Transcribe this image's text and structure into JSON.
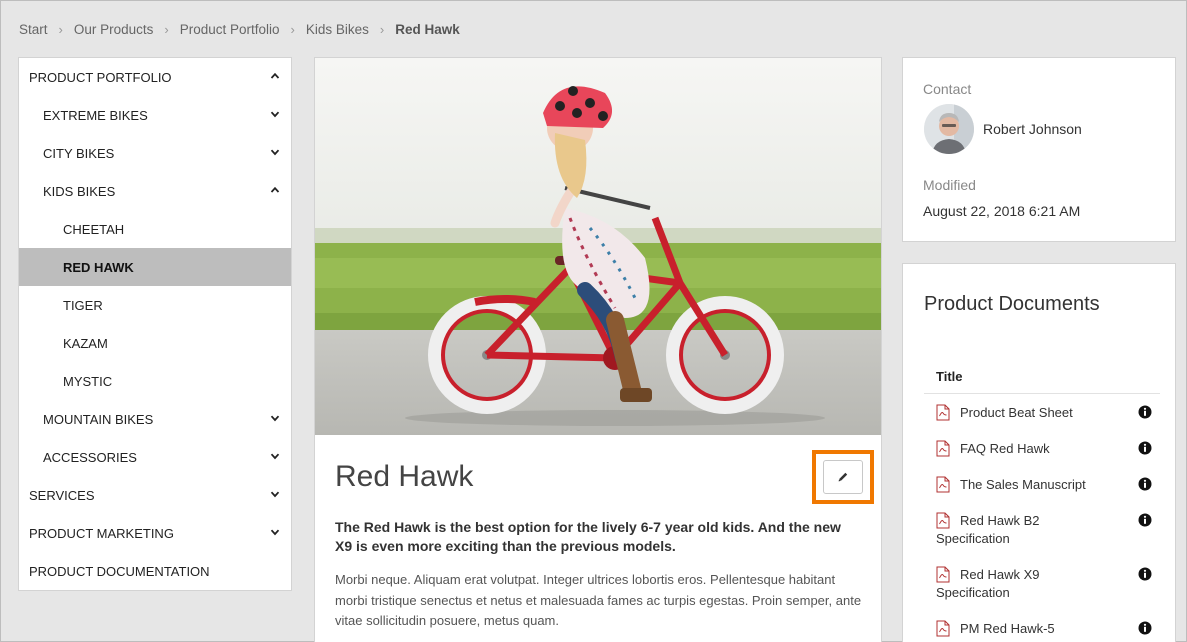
{
  "breadcrumb": {
    "items": [
      "Start",
      "Our Products",
      "Product Portfolio",
      "Kids Bikes"
    ],
    "current": "Red Hawk"
  },
  "nav": {
    "items": [
      {
        "label": "PRODUCT PORTFOLIO",
        "state": "expanded"
      },
      {
        "label": "EXTREME BIKES",
        "state": "collapsed"
      },
      {
        "label": "CITY BIKES",
        "state": "collapsed"
      },
      {
        "label": "KIDS BIKES",
        "state": "expanded"
      },
      {
        "label": "CHEETAH"
      },
      {
        "label": "RED HAWK",
        "active": true
      },
      {
        "label": "TIGER"
      },
      {
        "label": "KAZAM"
      },
      {
        "label": "MYSTIC"
      },
      {
        "label": "MOUNTAIN BIKES",
        "state": "collapsed"
      },
      {
        "label": "ACCESSORIES",
        "state": "collapsed"
      },
      {
        "label": "SERVICES",
        "state": "collapsed"
      },
      {
        "label": "PRODUCT MARKETING",
        "state": "collapsed"
      },
      {
        "label": "PRODUCT DOCUMENTATION"
      }
    ]
  },
  "product": {
    "title": "Red Hawk",
    "lead": "The Red Hawk is the best option for the lively 6-7 year old kids. And the new X9 is even more exciting than the previous models.",
    "body": "Morbi neque. Aliquam erat volutpat. Integer ultrices lobortis eros. Pellentesque habitant morbi tristique senectus et netus et malesuada fames ac turpis egestas. Proin semper, ante vitae sollicitudin posuere, metus quam."
  },
  "contact": {
    "label": "Contact",
    "name": "Robert Johnson",
    "modified_label": "Modified",
    "modified_value": "August 22, 2018 6:21 AM"
  },
  "documents": {
    "title": "Product Documents",
    "column": "Title",
    "items": [
      "Product Beat Sheet",
      "FAQ Red Hawk",
      "The Sales Manuscript",
      "Red Hawk B2 Specification",
      "Red Hawk X9 Specification",
      "PM Red Hawk-5"
    ]
  },
  "colors": {
    "highlight": "#f07800",
    "active_nav": "#bdbdbd",
    "bike_red": "#c8202c",
    "helmet": "#e8465a"
  },
  "icons": [
    "chevron-up-icon",
    "chevron-down-icon",
    "pencil-icon",
    "pdf-icon",
    "info-icon"
  ]
}
